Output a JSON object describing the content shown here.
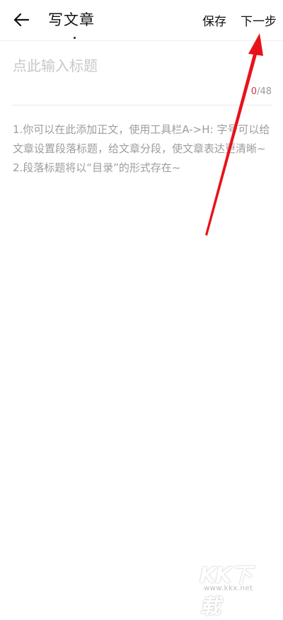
{
  "header": {
    "title": "写文章",
    "save_label": "保存",
    "next_label": "下一步",
    "back_icon": "arrow-left-icon"
  },
  "title_field": {
    "placeholder": "点此输入标题",
    "value": "",
    "counter_current": "0",
    "counter_max": "/48"
  },
  "body": {
    "hint_lines": [
      "1.你可以在此添加正文，使用工具栏A->H: 字号可以给文章设置段落标题，给文章分段，使文章表达更清晰~",
      "2.段落标题将以“目录”的形式存在~"
    ]
  },
  "colors": {
    "counter_accent": "#e0334b",
    "annotation_red": "#e8121a",
    "hint_text": "#9d9d9d"
  },
  "watermark": {
    "logo": "KK下载",
    "url": "www.kkx.net"
  }
}
